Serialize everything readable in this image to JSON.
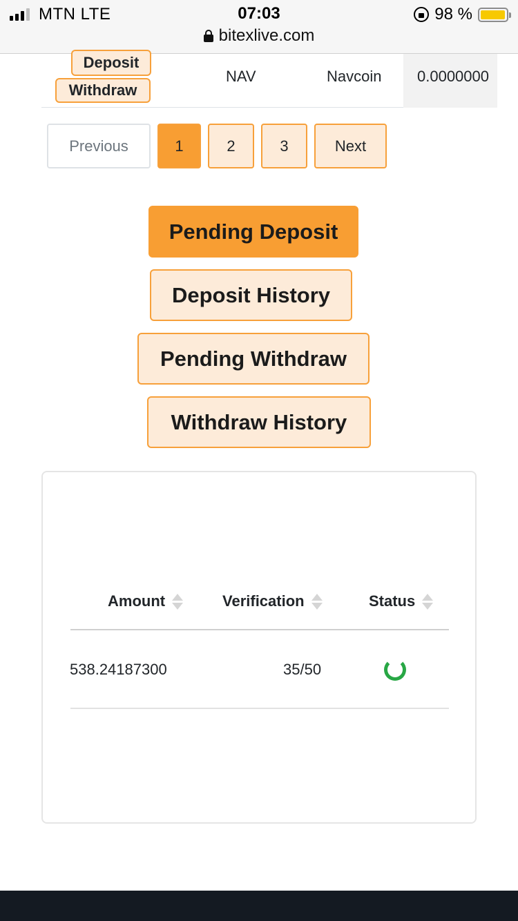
{
  "status_bar": {
    "carrier": "MTN  LTE",
    "time": "07:03",
    "battery": "98 %",
    "battery_level": 0.98,
    "url": "bitexlive.com",
    "icons": [
      "signal-icon",
      "orientation-lock-icon",
      "battery-icon",
      "padlock-icon"
    ]
  },
  "top_row": {
    "deposit_label": "Deposit",
    "withdraw_label": "Withdraw",
    "symbol": "NAV",
    "name": "Navcoin",
    "balance": "0.0000000"
  },
  "pagination": {
    "previous": "Previous",
    "pages": [
      "1",
      "2",
      "3"
    ],
    "active_page": "1",
    "next": "Next"
  },
  "actions": {
    "pending_deposit": "Pending Deposit",
    "deposit_history": "Deposit History",
    "pending_withdraw": "Pending Withdraw",
    "withdraw_history": "Withdraw History"
  },
  "pending_table": {
    "headers": [
      "Amount",
      "Verification",
      "Status"
    ],
    "rows": [
      {
        "amount": "538.24187300",
        "verification": "35/50",
        "status": "pending-spinner-icon"
      }
    ]
  },
  "colors": {
    "accent": "#f89e33",
    "accent_light": "#fdebd9",
    "status_green": "#28a745",
    "footer": "#141a22"
  }
}
